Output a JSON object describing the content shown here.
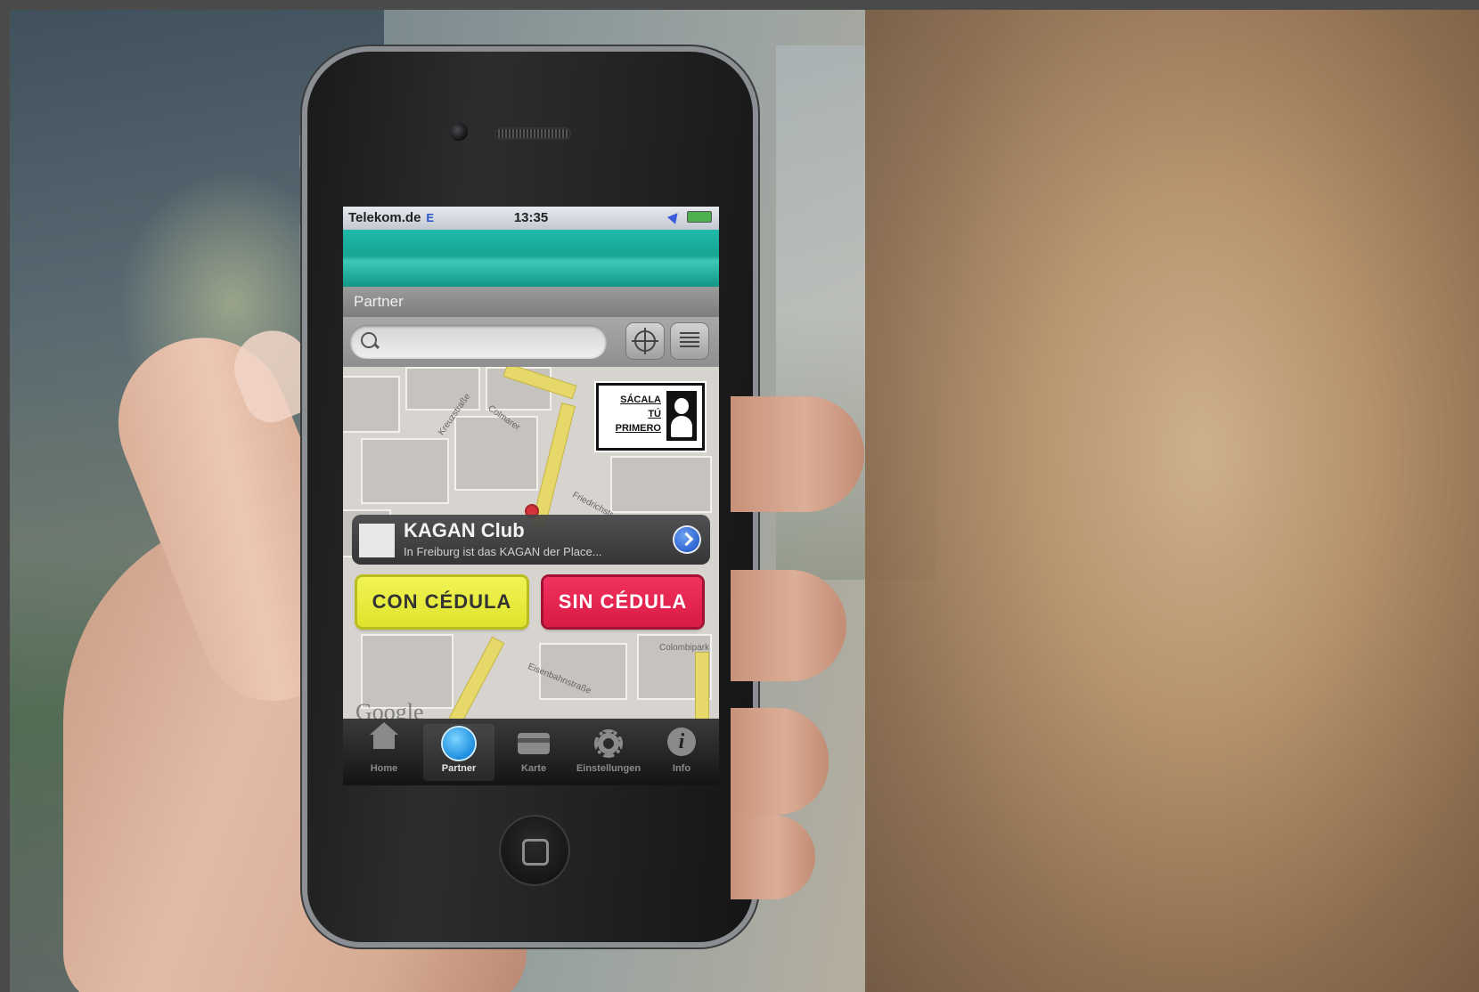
{
  "statusbar": {
    "carrier": "Telekom.de",
    "network": "E",
    "time": "13:35"
  },
  "navbar": {
    "title": "Partner"
  },
  "search": {
    "placeholder": ""
  },
  "map": {
    "streets": [
      "Colmarer",
      "Kreuzstraße",
      "Eisenbahnstraße",
      "Friedrichstr.",
      "Colombipark"
    ],
    "attribution": "Google"
  },
  "promo": {
    "lines": [
      "SÁCALA",
      "TÚ",
      "PRIMERO"
    ]
  },
  "callout": {
    "title": "KAGAN Club",
    "subtitle": "In Freiburg ist das KAGAN der Place..."
  },
  "buttons": {
    "con_cedula": "CON CÉDULA",
    "sin_cedula": "SIN CÉDULA"
  },
  "tabs": [
    {
      "label": "Home",
      "icon": "house-icon",
      "active": false
    },
    {
      "label": "Partner",
      "icon": "partner-icon",
      "active": true
    },
    {
      "label": "Karte",
      "icon": "card-icon",
      "active": false
    },
    {
      "label": "Einstellungen",
      "icon": "gear-icon",
      "active": false
    },
    {
      "label": "Info",
      "icon": "info-icon",
      "active": false
    }
  ],
  "colors": {
    "banner": "#17a594",
    "con_button": "#dfe32c",
    "sin_button": "#d91a45",
    "disclosure": "#2b62d1"
  }
}
